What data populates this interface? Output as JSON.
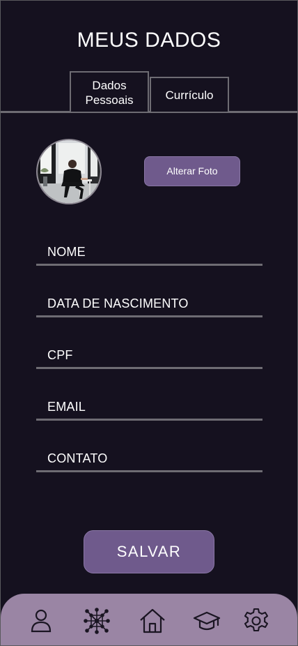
{
  "header": {
    "title": "MEUS DADOS"
  },
  "tabs": [
    {
      "label_line1": "Dados",
      "label_line2": "Pessoais",
      "active": true
    },
    {
      "label": "Currículo",
      "active": false
    }
  ],
  "profile": {
    "change_photo_label": "Alterar Foto"
  },
  "form": {
    "fields": [
      {
        "label": "NOME"
      },
      {
        "label": "DATA DE NASCIMENTO"
      },
      {
        "label": "CPF"
      },
      {
        "label": "EMAIL"
      },
      {
        "label": "CONTATO"
      }
    ],
    "save_label": "SALVAR"
  },
  "bottom_nav": {
    "items": [
      {
        "icon": "user-icon"
      },
      {
        "icon": "network-icon"
      },
      {
        "icon": "home-icon"
      },
      {
        "icon": "graduation-cap-icon"
      },
      {
        "icon": "gear-icon"
      }
    ]
  },
  "colors": {
    "background": "#15111f",
    "accent": "#6f5a8c",
    "nav_background": "#9a85a4",
    "divider": "#6e6c73"
  }
}
